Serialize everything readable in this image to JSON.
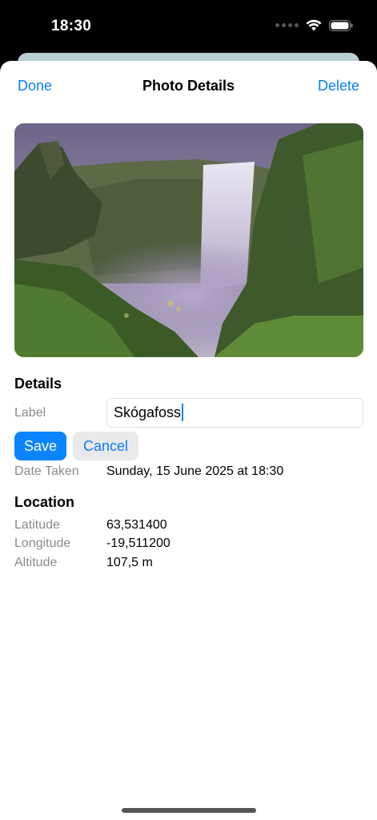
{
  "status_bar": {
    "time": "18:30"
  },
  "nav": {
    "done_label": "Done",
    "title": "Photo Details",
    "delete_label": "Delete"
  },
  "details": {
    "section_title": "Details",
    "label_label": "Label",
    "label_value": "Skógafoss",
    "save_label": "Save",
    "cancel_label": "Cancel",
    "date_label": "Date Taken",
    "date_value": "Sunday, 15 June 2025 at 18:30"
  },
  "location": {
    "section_title": "Location",
    "latitude_label": "Latitude",
    "latitude_value": "63,531400",
    "longitude_label": "Longitude",
    "longitude_value": "-19,511200",
    "altitude_label": "Altitude",
    "altitude_value": "107,5 m"
  },
  "colors": {
    "accent": "#0a7cff",
    "secondary_text": "#8a8a8e"
  }
}
